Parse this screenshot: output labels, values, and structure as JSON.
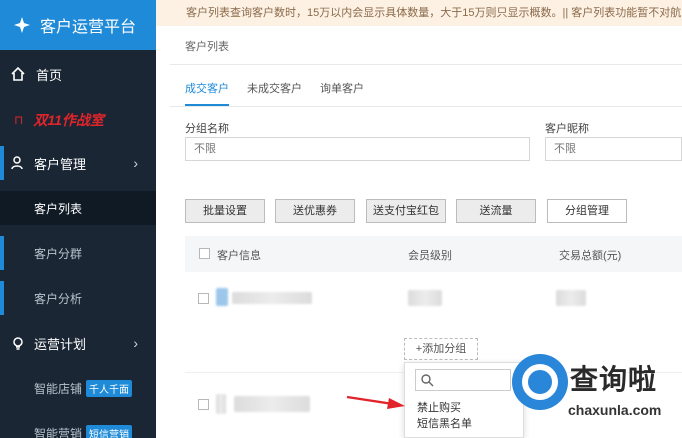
{
  "app": {
    "title": "客户运营平台"
  },
  "sidebar": {
    "home": "首页",
    "promo": {
      "flag": "⊓",
      "text": "双11作战室"
    },
    "customer_mgmt": {
      "label": "客户管理",
      "items": [
        "客户列表",
        "客户分群",
        "客户分析"
      ],
      "active": "客户列表"
    },
    "ops_plan": {
      "label": "运营计划",
      "items": [
        {
          "label": "智能店铺",
          "badge": "千人千面"
        },
        {
          "label": "智能营销",
          "badge": "短信营销"
        }
      ]
    }
  },
  "notice": "客户列表查询客户数时，15万以内会显示具体数量，大于15万则只显示概数。|| 客户列表功能暂不对航",
  "page": {
    "title": "客户列表"
  },
  "tabs": [
    "成交客户",
    "未成交客户",
    "询单客户"
  ],
  "active_tab": "成交客户",
  "filters": {
    "group_name": {
      "label": "分组名称",
      "placeholder": "不限"
    },
    "nickname": {
      "label": "客户昵称",
      "placeholder": "不限"
    }
  },
  "actions": [
    "批量设置",
    "送优惠券",
    "送支付宝红包",
    "送流量",
    "分组管理"
  ],
  "table": {
    "headers": [
      "客户信息",
      "会员级别",
      "交易总额(元)"
    ]
  },
  "group_popup": {
    "add_label": "+添加分组",
    "items": [
      "禁止购买",
      "短信黑名单"
    ]
  },
  "watermark": {
    "title": "查询啦",
    "url": "chaxunla.com"
  },
  "colors": {
    "sidebar_bg": "#1a2634",
    "accent": "#1f8ad8",
    "promo_red": "#e0242a"
  }
}
